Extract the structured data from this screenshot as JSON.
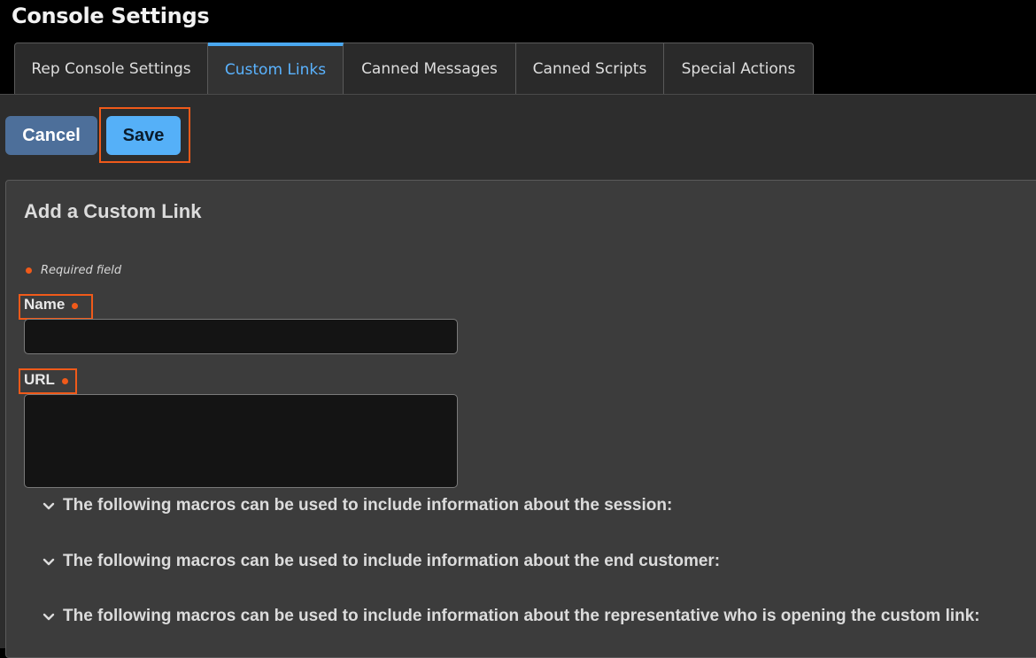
{
  "page_title": "Console Settings",
  "tabs": [
    {
      "label": "Rep Console Settings"
    },
    {
      "label": "Custom Links"
    },
    {
      "label": "Canned Messages"
    },
    {
      "label": "Canned Scripts"
    },
    {
      "label": "Special Actions"
    }
  ],
  "active_tab": "Custom Links",
  "actions": {
    "cancel_label": "Cancel",
    "save_label": "Save"
  },
  "form": {
    "heading": "Add a Custom Link",
    "required_note": "Required field",
    "name_label": "Name",
    "name_value": "",
    "url_label": "URL",
    "url_value": ""
  },
  "macros": [
    {
      "label": "The following macros can be used to include information about the session:"
    },
    {
      "label": "The following macros can be used to include information about the end customer:"
    },
    {
      "label": "The following macros can be used to include information about the representative who is opening the custom link:"
    }
  ],
  "colors": {
    "accent_blue": "#55b0f8",
    "active_tab_text": "#5ab3ff",
    "cancel_button": "#4d6f9a",
    "required_dot": "#f05a1a",
    "highlight_box": "#f05a1a"
  },
  "icons": [
    "chevron-down-icon",
    "required-dot-icon",
    "resize-handle-icon"
  ]
}
